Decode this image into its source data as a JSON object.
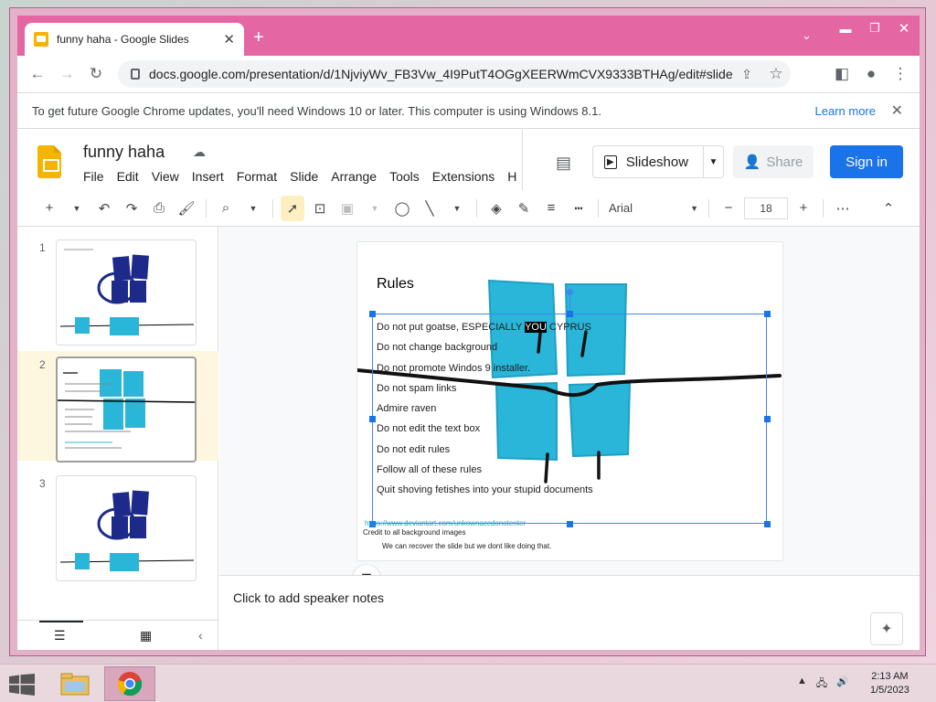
{
  "browser": {
    "tab_title": "funny haha - Google Slides",
    "url": "docs.google.com/presentation/d/1NjviyWv_FB3Vw_4I9PutT4OGgXEERWmCVX9333BTHAg/edit#slide=id.g...",
    "info_message": "To get future Google Chrome updates, you'll need Windows 10 or later. This computer is using Windows 8.1.",
    "learn_more": "Learn more"
  },
  "doc": {
    "title": "funny haha",
    "menus": [
      "File",
      "Edit",
      "View",
      "Insert",
      "Format",
      "Slide",
      "Arrange",
      "Tools",
      "Extensions",
      "H"
    ],
    "slideshow_label": "Slideshow",
    "share_label": "Share",
    "signin_label": "Sign in"
  },
  "toolbar": {
    "font": "Arial",
    "font_size": "18",
    "minus": "−",
    "plus": "+"
  },
  "filmstrip": {
    "slides": [
      {
        "num": "1"
      },
      {
        "num": "2"
      },
      {
        "num": "3"
      }
    ]
  },
  "slide": {
    "title": "Rules",
    "rules": [
      "Do not put goatse, ESPECIALLY",
      "YOU",
      " CYPRUS",
      "Do not change background",
      "Do not promote Windos 9 installer.",
      "Do not spam links",
      "Admire raven",
      "Do not edit the text box",
      "Do not edit rules",
      "Follow all of these rules",
      "Quit shoving fetishes into your stupid documents"
    ],
    "link": "https://www.deviantart.com/unkownaccdonotenter",
    "credit": "Credit to all background images",
    "recover": "We can recover the slide but we dont like doing that."
  },
  "notes": {
    "placeholder": "Click to add speaker notes"
  },
  "taskbar": {
    "time": "2:13 AM",
    "date": "1/5/2023"
  },
  "colors": {
    "accent": "#1a73e8",
    "window_frame": "#e467a4",
    "slides_yellow": "#f4b400",
    "blob": "#29b6d8",
    "dark_blob": "#1e2a8a"
  }
}
